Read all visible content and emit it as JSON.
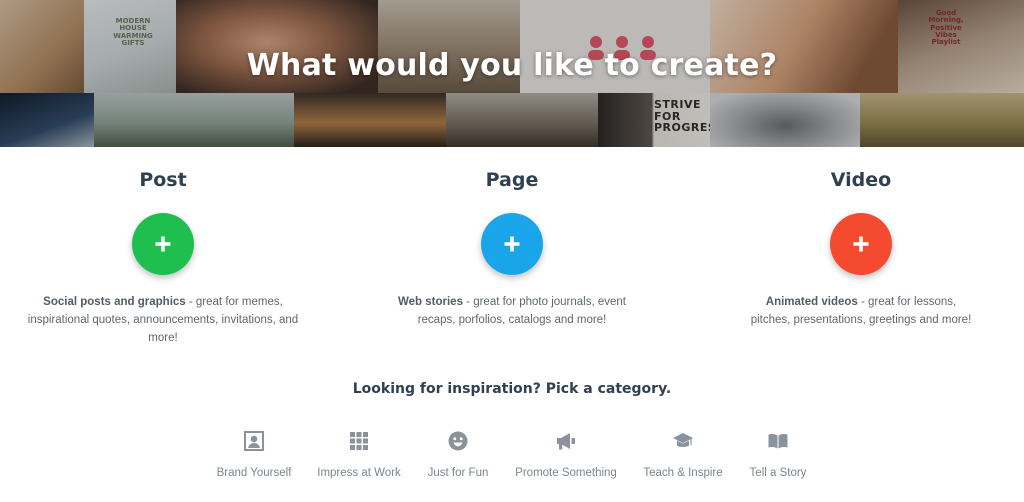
{
  "hero": {
    "title": "What would you like to create?",
    "tile_texts": {
      "warming_gifts": "MODERN HOUSE WARMING GIFTS",
      "strive": "STRIVE FOR PROGRESS",
      "good_morning": "Good Morning, Positive Vibes Playlist"
    }
  },
  "options": [
    {
      "title": "Post",
      "color": "#1fbf4f",
      "desc_bold": "Social posts and graphics",
      "desc_rest": " - great for memes, inspirational quotes, announcements, invitations, and more!"
    },
    {
      "title": "Page",
      "color": "#1aa5ea",
      "desc_bold": "Web stories",
      "desc_rest": " - great for photo journals, event recaps, porfolios, catalogs and more!"
    },
    {
      "title": "Video",
      "color": "#f44a30",
      "desc_bold": "Animated videos",
      "desc_rest": " - great for lessons, pitches, presentations, greetings and more!"
    }
  ],
  "inspiration": {
    "title": "Looking for inspiration? Pick a category.",
    "categories": [
      {
        "label": "Brand Yourself",
        "icon": "portrait-icon"
      },
      {
        "label": "Impress at Work",
        "icon": "grid-icon"
      },
      {
        "label": "Just for Fun",
        "icon": "smiley-icon"
      },
      {
        "label": "Promote Something",
        "icon": "megaphone-icon"
      },
      {
        "label": "Teach & Inspire",
        "icon": "graduation-cap-icon"
      },
      {
        "label": "Tell a Story",
        "icon": "open-book-icon"
      }
    ],
    "icon_color": "#8a939b"
  }
}
